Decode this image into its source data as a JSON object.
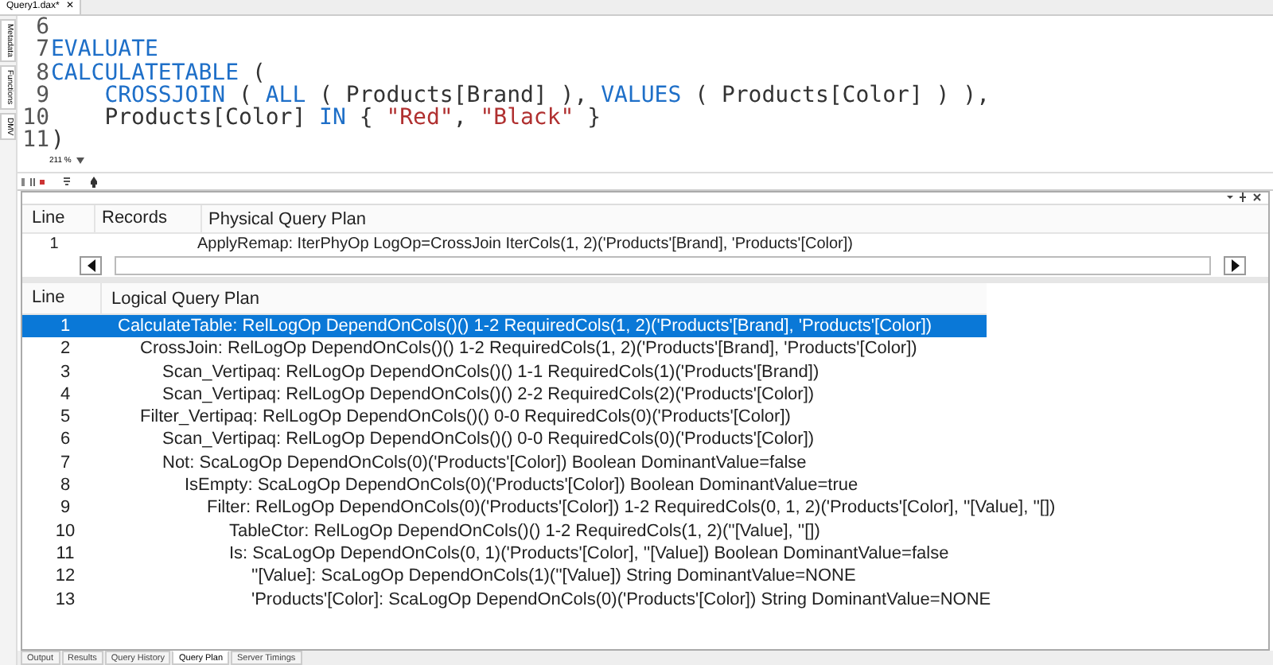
{
  "document_tab": {
    "title": "Query1.dax*",
    "close": "✕"
  },
  "side_tabs": [
    "Metadata",
    "Functions",
    "DMV"
  ],
  "editor": {
    "lines": [
      {
        "number": "6"
      },
      {
        "number": "7",
        "tokens": [
          {
            "kind": "keyword",
            "text": "EVALUATE"
          }
        ]
      },
      {
        "number": "8",
        "tokens": [
          {
            "kind": "keyword",
            "text": "CALCULATETABLE"
          },
          {
            "kind": "plain",
            "text": " ("
          }
        ]
      },
      {
        "number": "9",
        "indented": true,
        "tokens": [
          {
            "kind": "keyword",
            "text": "CROSSJOIN"
          },
          {
            "kind": "plain",
            "text": " ( "
          },
          {
            "kind": "keyword",
            "text": "ALL"
          },
          {
            "kind": "plain",
            "text": " ( Products[Brand] ), "
          },
          {
            "kind": "keyword",
            "text": "VALUES"
          },
          {
            "kind": "plain",
            "text": " ( Products[Color] ) ),"
          }
        ]
      },
      {
        "number": "10",
        "indented": true,
        "tokens": [
          {
            "kind": "plain",
            "text": "Products[Color] "
          },
          {
            "kind": "keyword",
            "text": "IN"
          },
          {
            "kind": "plain",
            "text": " { "
          },
          {
            "kind": "string",
            "text": "\"Red\""
          },
          {
            "kind": "plain",
            "text": ", "
          },
          {
            "kind": "string",
            "text": "\"Black\""
          },
          {
            "kind": "plain",
            "text": " }"
          }
        ]
      },
      {
        "number": "11",
        "tokens": [
          {
            "kind": "plain",
            "text": ")"
          }
        ]
      }
    ],
    "zoom": "211 %"
  },
  "physical_plan": {
    "columns": [
      "Line",
      "Records",
      "Physical Query Plan"
    ],
    "rows": [
      {
        "line": "1",
        "text": "ApplyRemap: IterPhyOp LogOp=CrossJoin IterCols(1, 2)('Products'[Brand], 'Products'[Color])"
      }
    ]
  },
  "logical_plan": {
    "columns": [
      "Line",
      "Logical Query Plan"
    ],
    "rows": [
      {
        "line": "1",
        "text": "CalculateTable: RelLogOp DependOnCols()() 1-2 RequiredCols(1, 2)('Products'[Brand], 'Products'[Color])",
        "selected": true,
        "children": [
          {
            "line": "2",
            "text": "CrossJoin: RelLogOp DependOnCols()() 1-2 RequiredCols(1, 2)('Products'[Brand], 'Products'[Color])",
            "selected": false,
            "children": [
              {
                "line": "3",
                "text": "Scan_Vertipaq: RelLogOp DependOnCols()() 1-1 RequiredCols(1)('Products'[Brand])",
                "selected": false
              },
              {
                "line": "4",
                "text": "Scan_Vertipaq: RelLogOp DependOnCols()() 2-2 RequiredCols(2)('Products'[Color])",
                "selected": false
              }
            ]
          },
          {
            "line": "5",
            "text": "Filter_Vertipaq: RelLogOp DependOnCols()() 0-0 RequiredCols(0)('Products'[Color])",
            "selected": false,
            "children": [
              {
                "line": "6",
                "text": "Scan_Vertipaq: RelLogOp DependOnCols()() 0-0 RequiredCols(0)('Products'[Color])",
                "selected": false
              },
              {
                "line": "7",
                "text": "Not: ScaLogOp DependOnCols(0)('Products'[Color]) Boolean DominantValue=false",
                "selected": false,
                "children": [
                  {
                    "line": "8",
                    "text": "IsEmpty: ScaLogOp DependOnCols(0)('Products'[Color]) Boolean DominantValue=true",
                    "selected": false,
                    "children": [
                      {
                        "line": "9",
                        "text": "Filter: RelLogOp DependOnCols(0)('Products'[Color]) 1-2 RequiredCols(0, 1, 2)('Products'[Color], ''[Value], ''[])",
                        "selected": false,
                        "children": [
                          {
                            "line": "10",
                            "text": "TableCtor: RelLogOp DependOnCols()() 1-2 RequiredCols(1, 2)(''[Value], ''[])",
                            "selected": false
                          },
                          {
                            "line": "11",
                            "text": "Is: ScaLogOp DependOnCols(0, 1)('Products'[Color], ''[Value]) Boolean DominantValue=false",
                            "selected": false,
                            "children": [
                              {
                                "line": "12",
                                "text": "''[Value]: ScaLogOp DependOnCols(1)(''[Value]) String DominantValue=NONE",
                                "selected": false
                              },
                              {
                                "line": "13",
                                "text": "'Products'[Color]: ScaLogOp DependOnCols(0)('Products'[Color]) String DominantValue=NONE",
                                "selected": false
                              }
                            ]
                          }
                        ]
                      }
                    ]
                  }
                ]
              }
            ]
          }
        ]
      }
    ]
  },
  "bottom_tabs": [
    {
      "label": "Output",
      "selected": false
    },
    {
      "label": "Results",
      "selected": false
    },
    {
      "label": "Query History",
      "selected": false
    },
    {
      "label": "Query Plan",
      "selected": true
    },
    {
      "label": "Server Timings",
      "selected": false
    }
  ]
}
